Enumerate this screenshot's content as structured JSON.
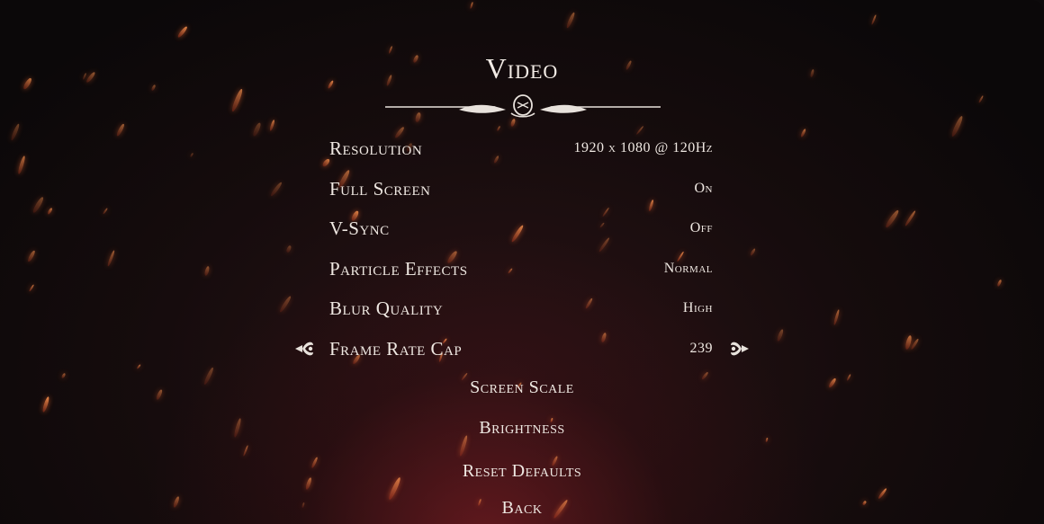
{
  "title": "Video",
  "settings": [
    {
      "label": "Resolution",
      "value": "1920 x 1080 @ 120Hz"
    },
    {
      "label": "Full Screen",
      "value": "On"
    },
    {
      "label": "V-Sync",
      "value": "Off"
    },
    {
      "label": "Particle Effects",
      "value": "Normal"
    },
    {
      "label": "Blur Quality",
      "value": "High"
    },
    {
      "label": "Frame Rate Cap",
      "value": "239"
    }
  ],
  "selected_index": 5,
  "menu_items": {
    "screen_scale": "Screen Scale",
    "brightness": "Brightness",
    "reset_defaults": "Reset Defaults",
    "back": "Back"
  },
  "colors": {
    "text": "#efe8e2",
    "ember": "#ff8a4a",
    "glow": "#7a1c22"
  },
  "icons": {
    "divider": "ornate-divider-icon",
    "selector_left": "fleur-selector-left-icon",
    "selector_right": "fleur-selector-right-icon"
  }
}
